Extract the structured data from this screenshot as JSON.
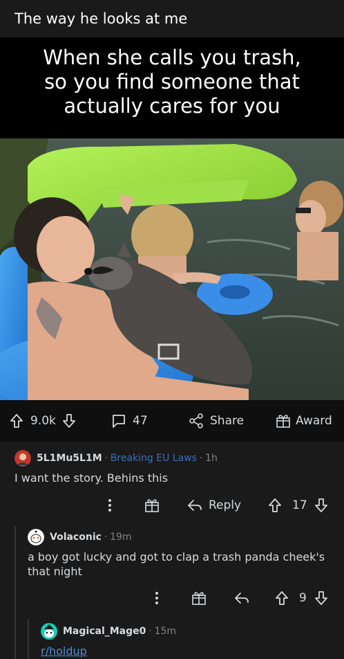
{
  "post": {
    "title": "The way he looks at me",
    "meme_caption_lines": [
      "When she calls you trash,",
      "so you find someone that",
      "actually cares for you"
    ]
  },
  "actions": {
    "upvotes": "9.0k",
    "comments": "47",
    "share_label": "Share",
    "award_label": "Award"
  },
  "comments": [
    {
      "username": "5L1Mu5L1M",
      "flair": "Breaking EU Laws",
      "time": "1h",
      "text": "I want the story. Behins this",
      "reply_label": "Reply",
      "votes": "17"
    },
    {
      "username": "Volaconic",
      "time": "19m",
      "text_lines": [
        "a boy got lucky and got to clap a trash panda cheek's",
        "that night"
      ],
      "votes": "9"
    },
    {
      "username": "Magical_Mage0",
      "time": "15m",
      "link_text": "r/holdup"
    }
  ],
  "colors": {
    "background": "#1a1a1b",
    "text": "#d7dadc",
    "muted": "#818384",
    "flair_blue": "#3b6db8",
    "link_blue": "#4f8fd8"
  }
}
